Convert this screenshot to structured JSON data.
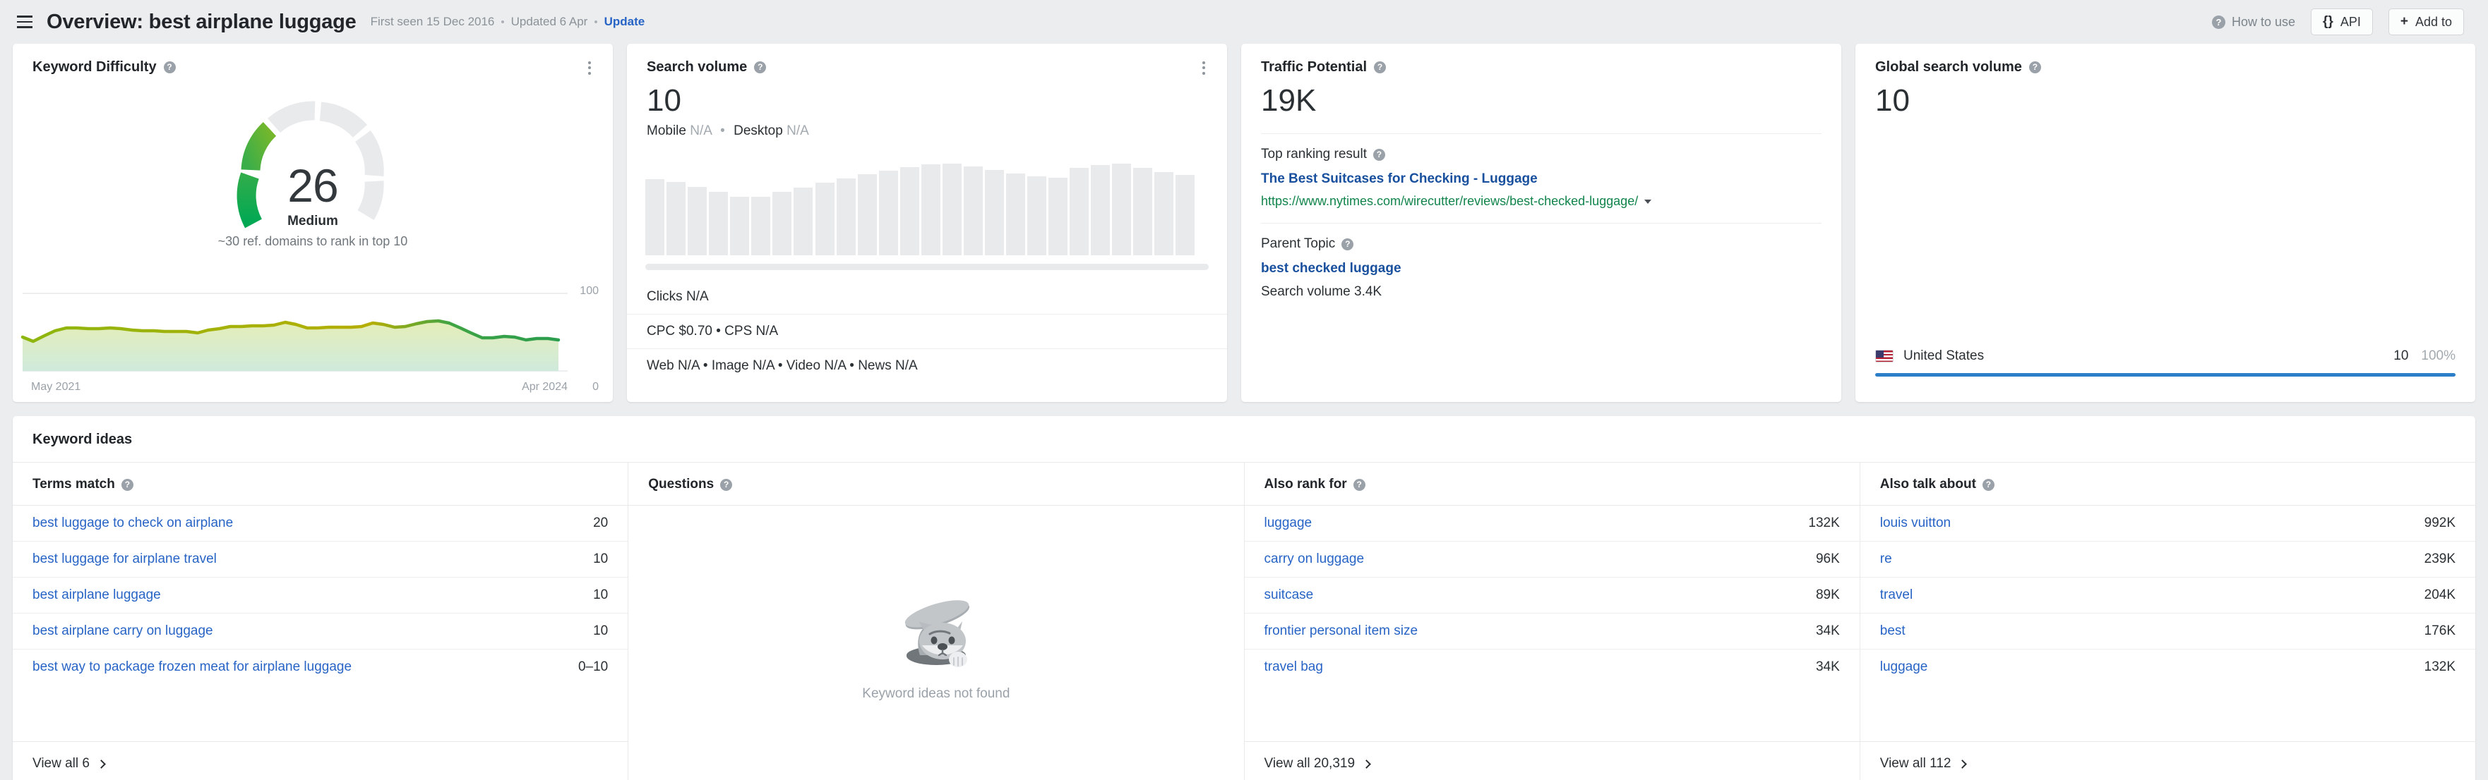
{
  "header": {
    "menu_icon": "hamburger-icon",
    "title": "Overview: best airplane luggage",
    "first_seen": "First seen 15 Dec 2016",
    "updated": "Updated 6 Apr",
    "update_link": "Update",
    "how_to_use": "How to use",
    "api_button": "API",
    "api_glyph": "{}",
    "add_to_button": "Add to",
    "add_to_glyph": "+"
  },
  "keyword_difficulty": {
    "title": "Keyword Difficulty",
    "value": "26",
    "label": "Medium",
    "note": "~30 ref. domains to rank in top 10",
    "axis_top": "100",
    "axis_bottom": "0",
    "x_start": "May 2021",
    "x_end": "Apr 2024"
  },
  "search_volume": {
    "title": "Search volume",
    "value": "10",
    "mobile_label": "Mobile",
    "mobile_value": "N/A",
    "desktop_label": "Desktop",
    "desktop_value": "N/A",
    "clicks_label": "Clicks",
    "clicks_value": "N/A",
    "cpc_label": "CPC",
    "cpc_value": "$0.70",
    "cps_label": "CPS",
    "cps_value": "N/A",
    "web_label": "Web",
    "web_value": "N/A",
    "image_label": "Image",
    "image_value": "N/A",
    "video_label": "Video",
    "video_value": "N/A",
    "news_label": "News",
    "news_value": "N/A"
  },
  "traffic_potential": {
    "title": "Traffic Potential",
    "value": "19K",
    "top_ranking_label": "Top ranking result",
    "top_ranking_title": "The Best Suitcases for Checking - Luggage",
    "top_ranking_url": "https://www.nytimes.com/wirecutter/reviews/best-checked-luggage/",
    "parent_topic_label": "Parent Topic",
    "parent_topic_value": "best checked luggage",
    "parent_search_volume": "Search volume 3.4K"
  },
  "global_search_volume": {
    "title": "Global search volume",
    "value": "10",
    "country": "United States",
    "country_flag": "us-flag-icon",
    "country_value": "10",
    "country_percent": "100%",
    "bar_fill_percent": 100,
    "bar_color": "#2d7ec9"
  },
  "keyword_ideas": {
    "title": "Keyword ideas",
    "columns": [
      {
        "title": "Terms match",
        "rows": [
          {
            "name": "best luggage to check on airplane",
            "value": "20"
          },
          {
            "name": "best luggage for airplane travel",
            "value": "10"
          },
          {
            "name": "best airplane luggage",
            "value": "10"
          },
          {
            "name": "best airplane carry on luggage",
            "value": "10"
          },
          {
            "name": "best way to package frozen meat for airplane luggage",
            "value": "0–10"
          }
        ],
        "view_all": "View all 6"
      },
      {
        "title": "Questions",
        "rows": [],
        "empty_text": "Keyword ideas not found",
        "empty_illustration": "cat-in-manhole-illustration"
      },
      {
        "title": "Also rank for",
        "rows": [
          {
            "name": "luggage",
            "value": "132K"
          },
          {
            "name": "carry on luggage",
            "value": "96K"
          },
          {
            "name": "suitcase",
            "value": "89K"
          },
          {
            "name": "frontier personal item size",
            "value": "34K"
          },
          {
            "name": "travel bag",
            "value": "34K"
          }
        ],
        "view_all": "View all 20,319"
      },
      {
        "title": "Also talk about",
        "rows": [
          {
            "name": "louis vuitton",
            "value": "992K"
          },
          {
            "name": "re",
            "value": "239K"
          },
          {
            "name": "travel",
            "value": "204K"
          },
          {
            "name": "best",
            "value": "176K"
          },
          {
            "name": "luggage",
            "value": "132K"
          }
        ],
        "view_all": "View all 112"
      }
    ]
  },
  "chart_data": [
    {
      "type": "line",
      "name": "keyword-difficulty-history",
      "title": "Keyword Difficulty over time",
      "xlabel": "",
      "ylabel": "",
      "ylim": [
        0,
        100
      ],
      "x": [
        "May 2021",
        "Apr 2024"
      ],
      "values": [
        31,
        29,
        34,
        35,
        35,
        35,
        34,
        34,
        33,
        33,
        32,
        34,
        36,
        36,
        36,
        37,
        38,
        37,
        36,
        36,
        36,
        36,
        36,
        37,
        37,
        38,
        38,
        40,
        39,
        37,
        36,
        36,
        37,
        37,
        39,
        38,
        37,
        41,
        42,
        41,
        38,
        35,
        32,
        32,
        33,
        32,
        31,
        32,
        31,
        30
      ],
      "line_color": "#8db60f",
      "end_color": "#2a9d4e",
      "fill": "gradient",
      "grid": false
    },
    {
      "type": "bar",
      "name": "search-volume-history",
      "title": "Search volume history",
      "xlabel": "",
      "ylabel": "",
      "values": [
        64,
        61,
        56,
        52,
        48,
        48,
        52,
        56,
        60,
        63,
        68,
        72,
        76,
        80,
        82,
        80,
        76,
        72,
        68,
        80,
        83,
        78,
        74,
        68,
        64,
        60
      ],
      "bar_color": "#e9eaec",
      "grid": false
    }
  ]
}
